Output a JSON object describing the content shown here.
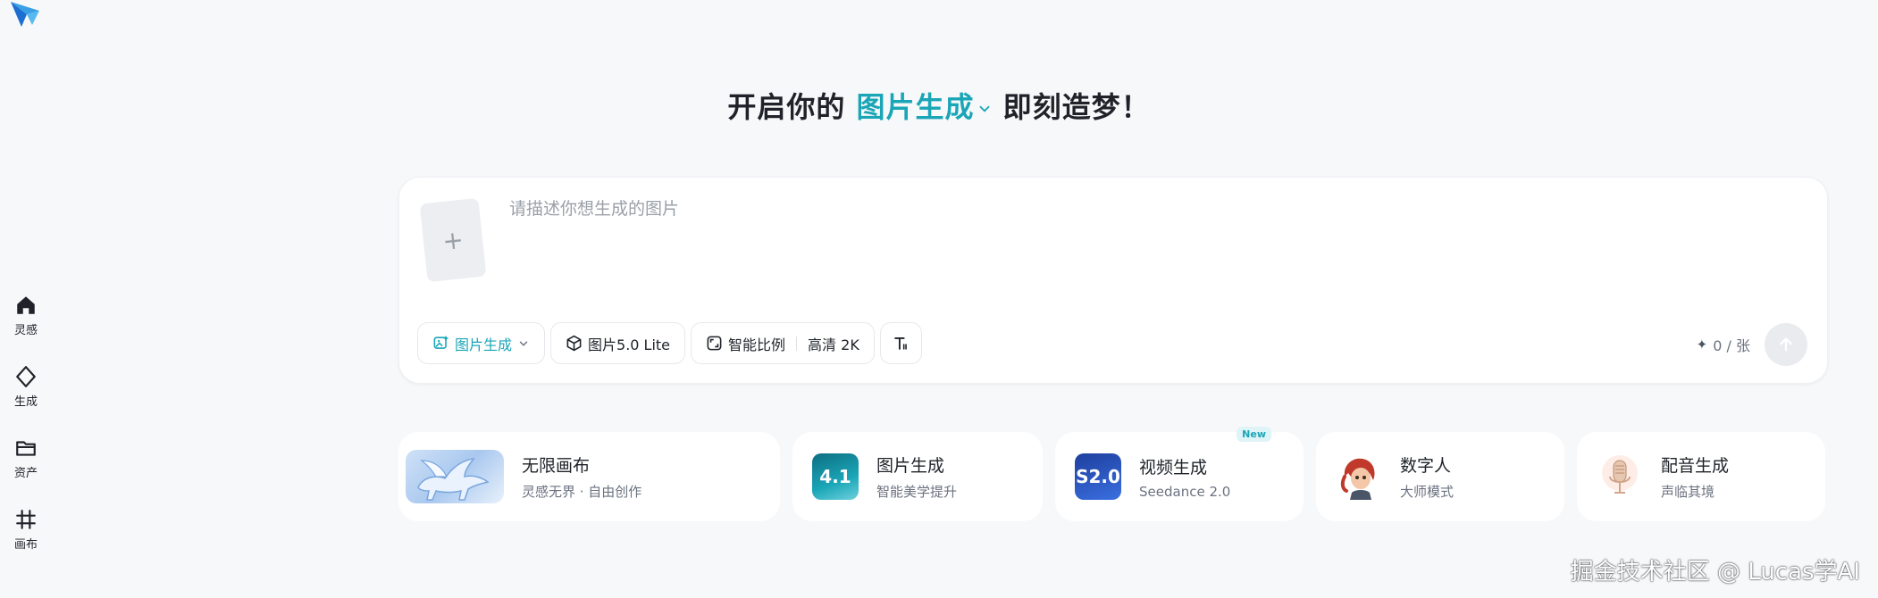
{
  "headline": {
    "prefix": "开启你的",
    "accent": "图片生成",
    "suffix": "即刻造梦！"
  },
  "sidebar": {
    "items": [
      {
        "label": "灵感",
        "icon": "home-icon"
      },
      {
        "label": "生成",
        "icon": "sparkle-diamond-icon"
      },
      {
        "label": "资产",
        "icon": "folder-icon"
      },
      {
        "label": "画布",
        "icon": "canvas-grid-icon"
      }
    ]
  },
  "composer": {
    "placeholder": "请描述你想生成的图片",
    "upload_symbol": "+",
    "mode_label": "图片生成",
    "model_label": "图片5.0 Lite",
    "ratio_label": "智能比例",
    "quality_label": "高清 2K",
    "credits": "0 / 张"
  },
  "features": [
    {
      "title": "无限画布",
      "subtitle": "灵感无界 · 自由创作",
      "thumb": "pegasus"
    },
    {
      "title": "图片生成",
      "subtitle": "智能美学提升",
      "thumb_text": "4.1"
    },
    {
      "title": "视频生成",
      "subtitle": "Seedance 2.0",
      "thumb_text": "S2.0",
      "badge": "New"
    },
    {
      "title": "数字人",
      "subtitle": "大师模式",
      "thumb": "avatar"
    },
    {
      "title": "配音生成",
      "subtitle": "声临其境",
      "thumb": "microphone"
    }
  ],
  "watermark": "掘金技术社区 @ Lucas学AI",
  "colors": {
    "accent": "#1aa6b7",
    "background": "#f7f8fa"
  }
}
